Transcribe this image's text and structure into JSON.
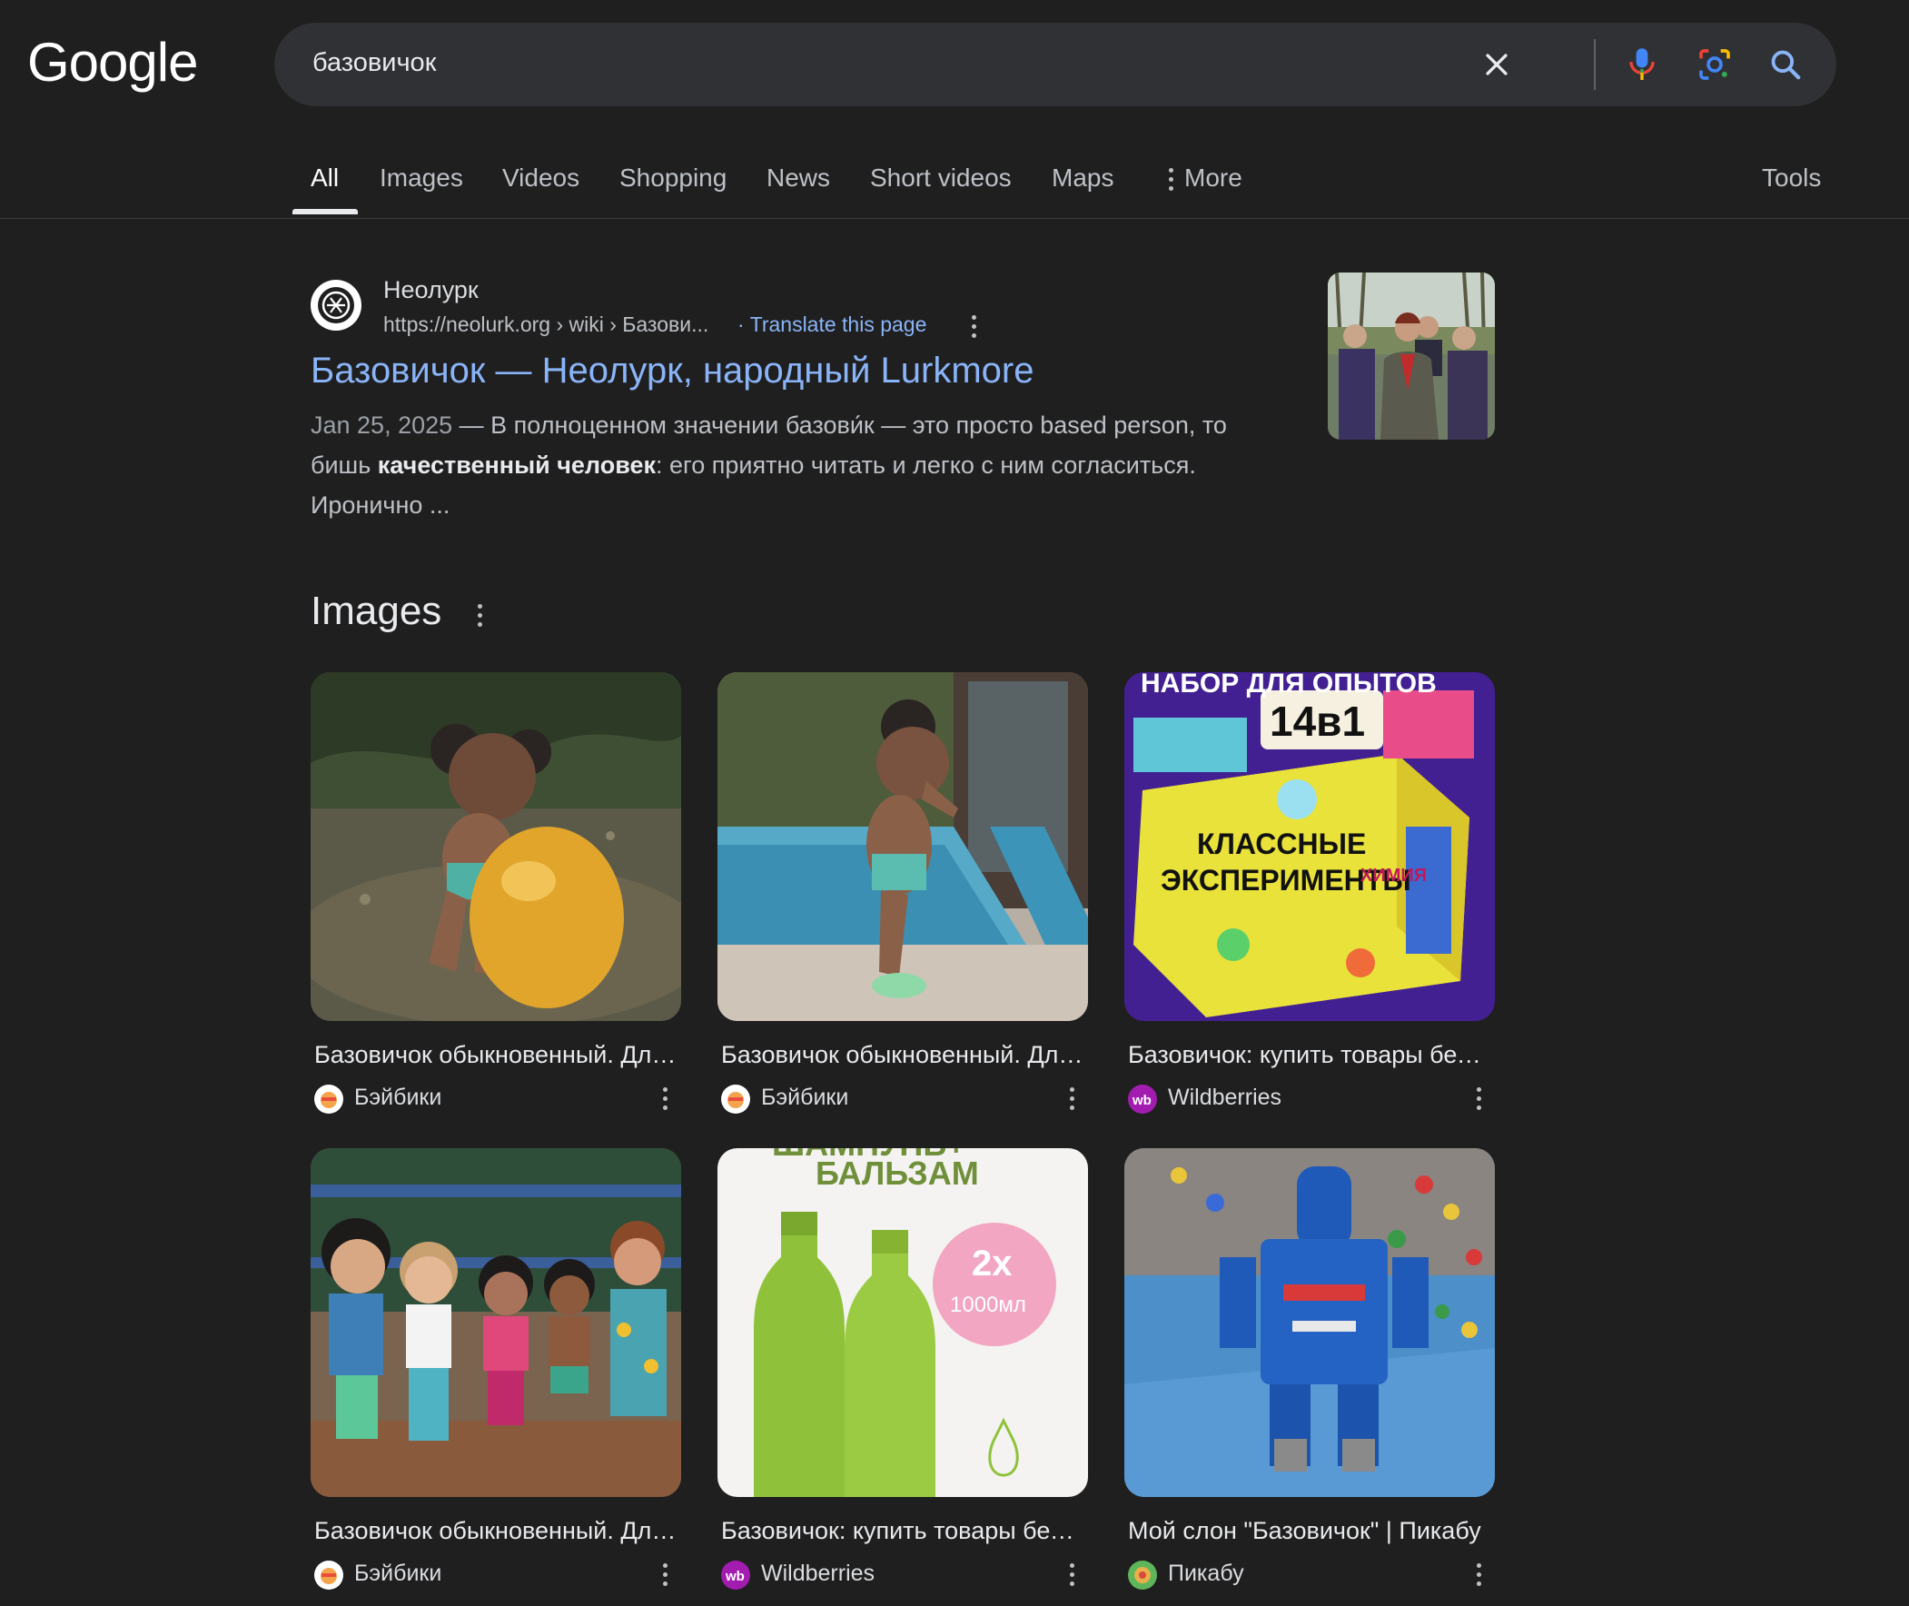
{
  "logo": "Google",
  "search": {
    "query": "базовичок"
  },
  "tabs": [
    "All",
    "Images",
    "Videos",
    "Shopping",
    "News",
    "Short videos",
    "Maps",
    "More"
  ],
  "tools_label": "Tools",
  "result": {
    "site_name": "Неолурк",
    "url": "https://neolurk.org › wiki › Базови...",
    "translate": "· Translate this page",
    "title": "Базовичок — Неолурк, народный Lurkmore",
    "date": "Jan 25, 2025",
    "snippet_a": " — В полноценном значении базови́к — это просто based person, то бишь ",
    "snippet_bold": "качественный человек",
    "snippet_b": ": его приятно читать и легко с ним согласиться. Иронично ..."
  },
  "images_heading": "Images",
  "image_cards": [
    {
      "caption": "Базовичок обыкновенный. Для ...",
      "source": "Бэйбики"
    },
    {
      "caption": "Базовичок обыкновенный. Для ...",
      "source": "Бэйбики"
    },
    {
      "caption": "Базовичок: купить товары без ...",
      "source": "Wildberries",
      "texts": [
        "НАБОР ДЛЯ ОПЫТОВ",
        "14в1",
        "КЛАССНЫЕ",
        "ЭКСПЕРИМЕНТЫ",
        "ХИМИЯ"
      ]
    },
    {
      "caption": "Базовичок обыкновенный. Для ...",
      "source": "Бэйбики"
    },
    {
      "caption": "Базовичок: купить товары без ...",
      "source": "Wildberries",
      "texts": [
        "ШАМПУНЬ+",
        "БАЛЬЗАМ",
        "2х",
        "1000мл"
      ]
    },
    {
      "caption": "Мой слон \"Базовичок\" | Пикабу",
      "source": "Пикабу"
    }
  ],
  "colors": {
    "background": "#1f1f1f",
    "link": "#8ab4f8",
    "search_bg": "#303134"
  }
}
